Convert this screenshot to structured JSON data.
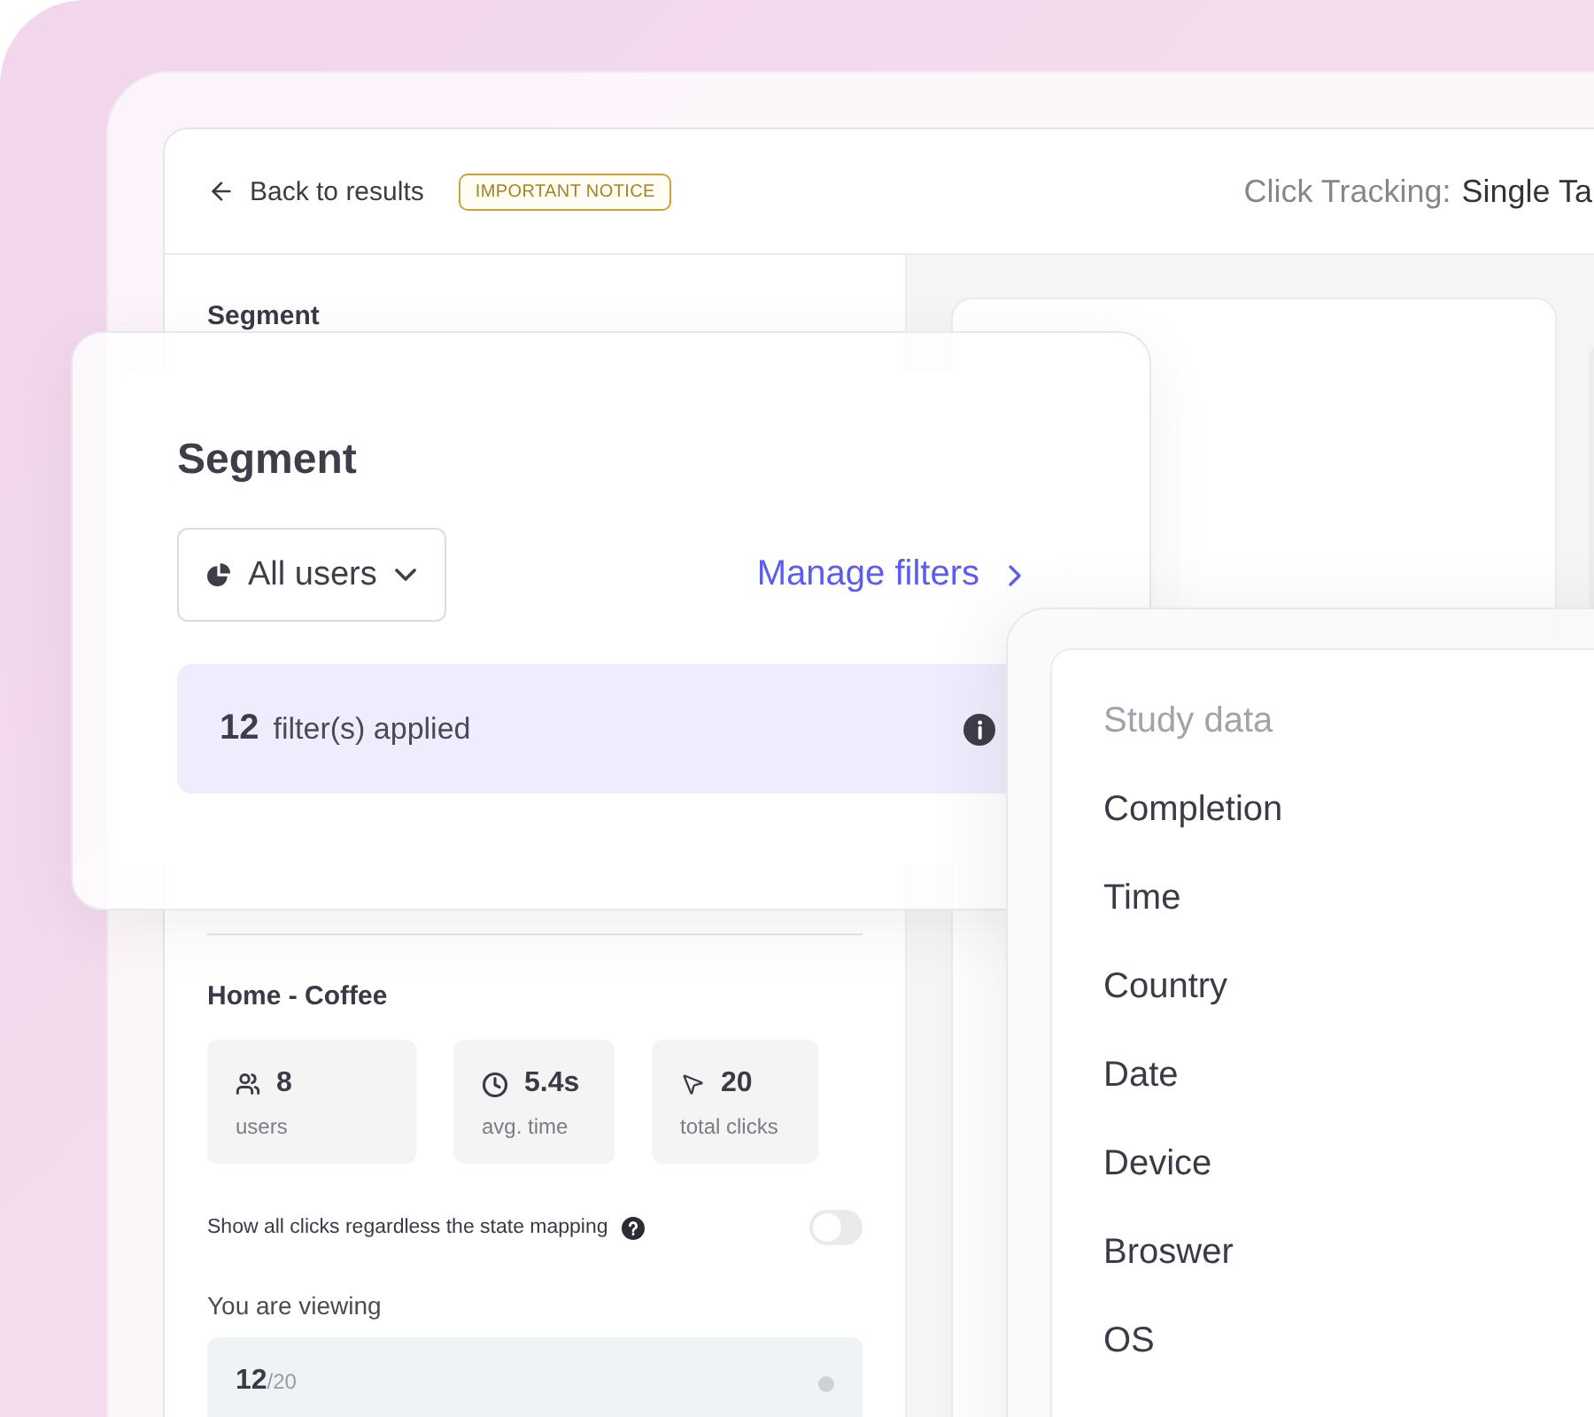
{
  "header": {
    "back_link": "Back to results",
    "badge": "IMPORTANT NOTICE",
    "title_prefix": "Click Tracking:",
    "title": "Single Ta"
  },
  "sidebar": {
    "heading": "Segment",
    "section_title": "Home - Coffee",
    "stats": [
      {
        "kind": "users",
        "value": "8",
        "label": "users"
      },
      {
        "kind": "time",
        "value": "5.4s",
        "label": "avg. time"
      },
      {
        "kind": "clicks",
        "value": "20",
        "label": "total clicks"
      }
    ],
    "toggle": {
      "label": "Show all clicks regardless the state mapping",
      "on": false
    },
    "viewing_label": "You are viewing",
    "viewing": {
      "count": "12",
      "total": "/20"
    }
  },
  "segment_card": {
    "title": "Segment",
    "dropdown": "All users",
    "link": "Manage filters",
    "filters": {
      "count": "12",
      "label": "filter(s) applied"
    }
  },
  "menu": {
    "header": "Study data",
    "items": [
      "Completion",
      "Time",
      "Country",
      "Date",
      "Device",
      "Broswer",
      "OS"
    ]
  }
}
